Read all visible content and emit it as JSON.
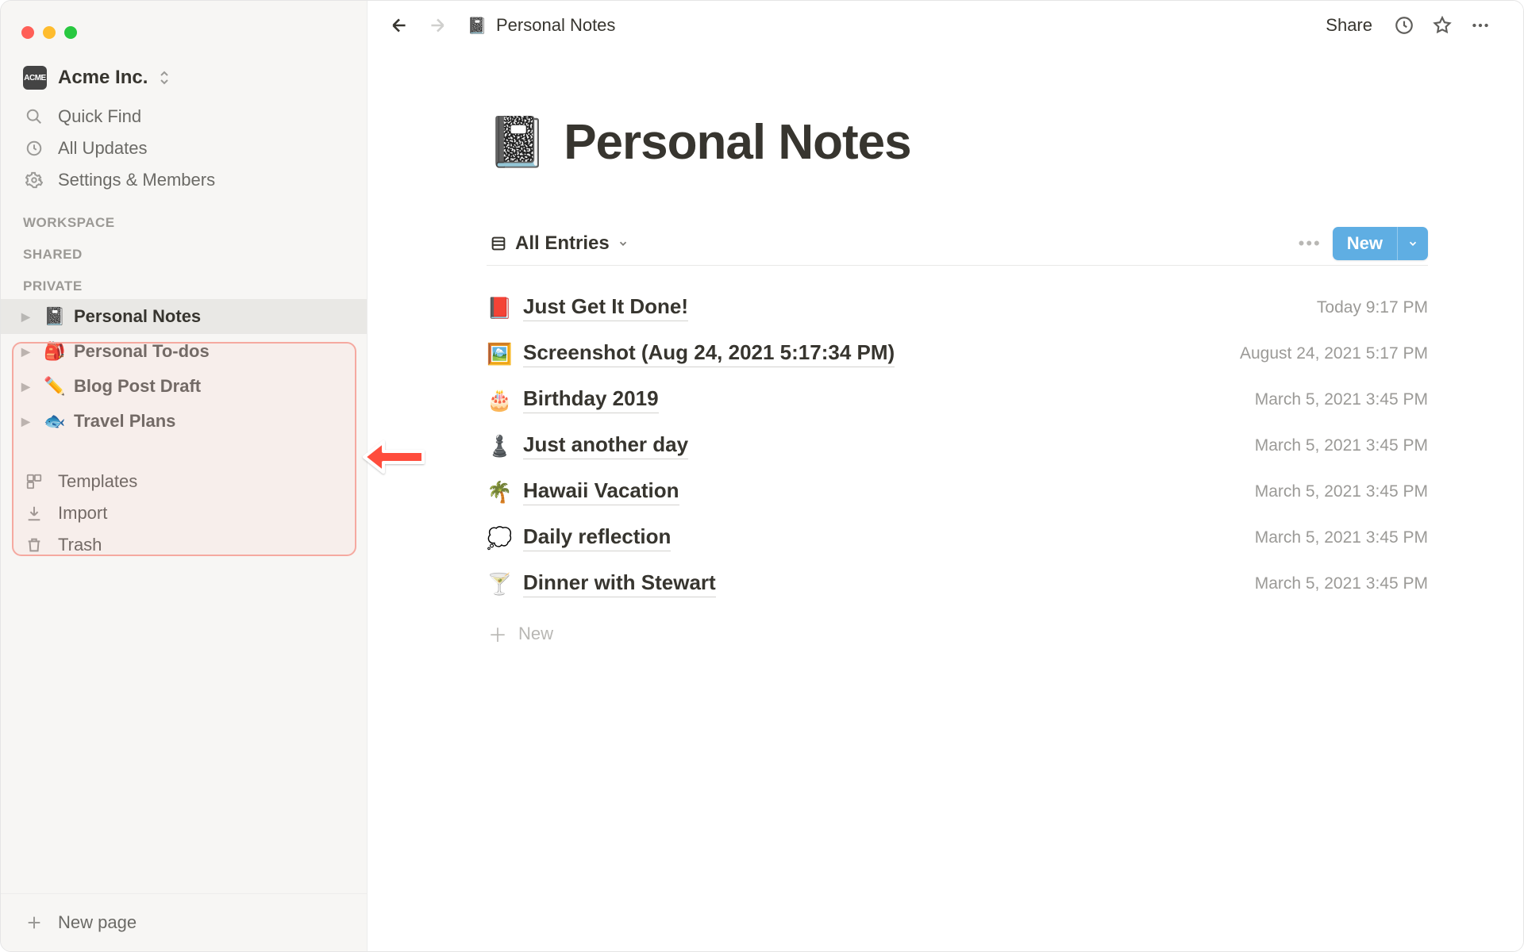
{
  "workspace": {
    "name": "Acme Inc.",
    "badge": "ACME"
  },
  "sidebar": {
    "quick_find": "Quick Find",
    "all_updates": "All Updates",
    "settings": "Settings & Members",
    "sections": {
      "workspace": "WORKSPACE",
      "shared": "SHARED",
      "private": "PRIVATE"
    },
    "private_pages": [
      {
        "emoji": "📓",
        "label": "Personal Notes",
        "active": true
      },
      {
        "emoji": "🎒",
        "label": "Personal To-dos",
        "active": false
      },
      {
        "emoji": "✏️",
        "label": "Blog Post Draft",
        "active": false
      },
      {
        "emoji": "🐟",
        "label": "Travel Plans",
        "active": false
      }
    ],
    "templates": "Templates",
    "import": "Import",
    "trash": "Trash",
    "new_page": "New page"
  },
  "topbar": {
    "breadcrumb_emoji": "📓",
    "breadcrumb": "Personal Notes",
    "share": "Share"
  },
  "page": {
    "emoji": "📓",
    "title": "Personal Notes",
    "view_label": "All Entries",
    "new_button": "New",
    "new_row": "New"
  },
  "entries": [
    {
      "emoji": "📕",
      "title": "Just Get It Done!",
      "date": "Today 9:17 PM"
    },
    {
      "emoji": "🖼️",
      "title": "Screenshot (Aug 24, 2021 5:17:34 PM)",
      "date": "August 24, 2021 5:17 PM"
    },
    {
      "emoji": "🎂",
      "title": "Birthday 2019",
      "date": "March 5, 2021 3:45 PM"
    },
    {
      "emoji": "♟️",
      "title": "Just another day",
      "date": "March 5, 2021 3:45 PM"
    },
    {
      "emoji": "🌴",
      "title": "Hawaii Vacation",
      "date": "March 5, 2021 3:45 PM"
    },
    {
      "emoji": "💭",
      "title": "Daily reflection",
      "date": "March 5, 2021 3:45 PM"
    },
    {
      "emoji": "🍸",
      "title": "Dinner with Stewart",
      "date": "March 5, 2021 3:45 PM"
    }
  ],
  "colors": {
    "accent": "#5faee3",
    "highlight": "#f5a9a0"
  }
}
